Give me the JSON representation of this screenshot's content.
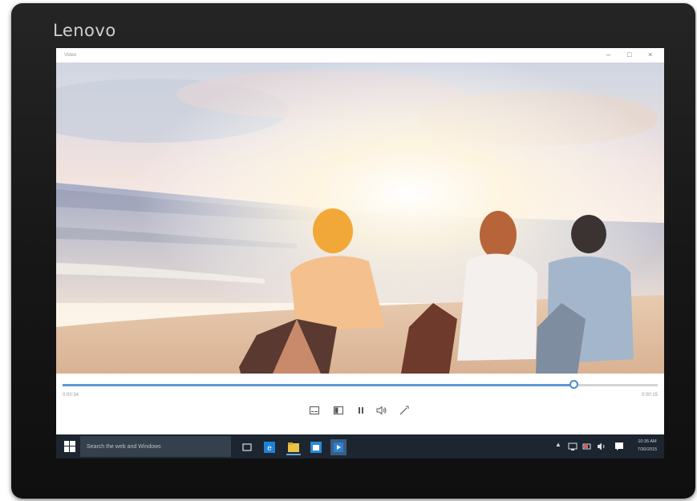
{
  "device": {
    "brand": "Lenovo"
  },
  "window": {
    "title": "Video",
    "controls": {
      "minimize": "–",
      "maximize": "□",
      "close": "×"
    }
  },
  "player": {
    "elapsed": "0:00:34",
    "remaining": "0:00:15",
    "progress": 0.86,
    "icons": [
      "subtitles-icon",
      "mini-view-icon",
      "pause-icon",
      "volume-icon",
      "cast-icon"
    ]
  },
  "taskbar": {
    "search_placeholder": "Search the web and Windows",
    "clock_time": "10:35 AM",
    "clock_date": "7/30/2015",
    "pinned_apps": [
      "task-view",
      "edge",
      "file-explorer",
      "store",
      "movies-tv"
    ]
  },
  "colors": {
    "accent": "#4c8bcb",
    "taskbar": "#1c2530",
    "bezel": "#1a1a1a"
  }
}
